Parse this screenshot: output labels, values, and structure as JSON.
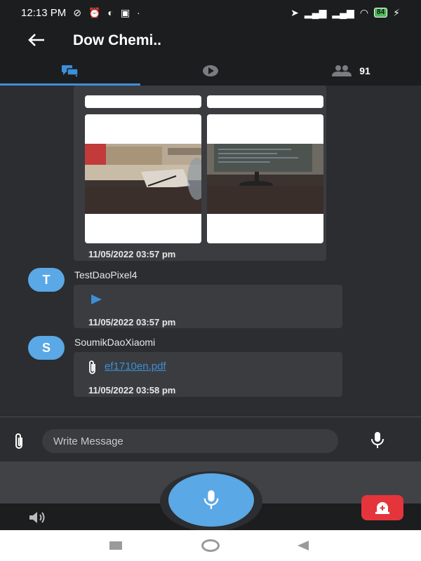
{
  "status_bar": {
    "time": "12:13 PM",
    "battery": "84"
  },
  "header": {
    "back_icon": "arrow-left-icon",
    "title": "Dow Chemi.."
  },
  "tabs": [
    {
      "icon": "chat-bubbles-icon",
      "active": true
    },
    {
      "icon": "play-circle-icon",
      "active": false
    },
    {
      "icon": "group-icon",
      "count": "91",
      "active": false
    }
  ],
  "messages": [
    {
      "type": "images",
      "timestamp": "11/05/2022 03:57 pm"
    },
    {
      "type": "audio",
      "avatar_letter": "T",
      "sender": "TestDaoPixel4",
      "timestamp": "11/05/2022 03:57 pm"
    },
    {
      "type": "file",
      "avatar_letter": "S",
      "sender": "SoumikDaoXiaomi",
      "file_name": "ef1710en.pdf",
      "timestamp": "11/05/2022 03:58 pm"
    }
  ],
  "composer": {
    "placeholder": "Write Message"
  },
  "colors": {
    "accent": "#3d8fd8",
    "avatar": "#5aa8e6",
    "alarm": "#e5353c",
    "background": "#2b2d30"
  }
}
